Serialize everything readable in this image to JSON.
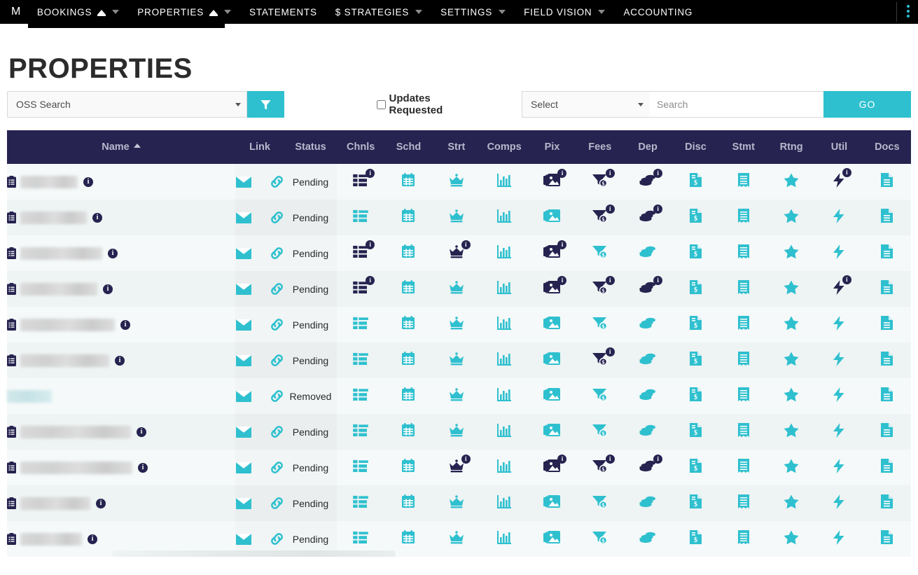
{
  "navbar": {
    "brand": "M",
    "items": [
      {
        "label": "BOOKINGS",
        "icon": "tab-badge-icon",
        "has_badge": true,
        "has_caret": true,
        "active": false
      },
      {
        "label": "PROPERTIES",
        "icon": "tab-badge-icon",
        "has_badge": true,
        "has_caret": true,
        "active": true
      },
      {
        "label": "STATEMENTS",
        "icon": "",
        "has_badge": false,
        "has_caret": false,
        "active": false
      },
      {
        "label": "$ STRATEGIES",
        "icon": "",
        "has_badge": false,
        "has_caret": true,
        "active": false
      },
      {
        "label": "SETTINGS",
        "icon": "",
        "has_badge": false,
        "has_caret": true,
        "active": false
      },
      {
        "label": "FIELD VISION",
        "icon": "",
        "has_badge": false,
        "has_caret": true,
        "active": false
      },
      {
        "label": "ACCOUNTING",
        "icon": "",
        "has_badge": false,
        "has_caret": false,
        "active": false
      }
    ],
    "kebab_icon": "vertical-dots-icon",
    "accent": "#2fc0cf"
  },
  "page": {
    "title": "PROPERTIES"
  },
  "filterbar": {
    "oss_select_value": "OSS Search",
    "filter_button_icon": "funnel-icon",
    "updates_requested_label": "Updates Requested",
    "updates_requested_checked": false,
    "type_select_value": "Select",
    "search_value": "",
    "search_placeholder": "Search",
    "go_label": "GO"
  },
  "table": {
    "columns": [
      {
        "key": "name",
        "label": "Name",
        "sorted": "asc"
      },
      {
        "key": "link",
        "label": "Link"
      },
      {
        "key": "status",
        "label": "Status"
      },
      {
        "key": "chnls",
        "label": "Chnls"
      },
      {
        "key": "schd",
        "label": "Schd"
      },
      {
        "key": "strt",
        "label": "Strt"
      },
      {
        "key": "comps",
        "label": "Comps"
      },
      {
        "key": "pix",
        "label": "Pix"
      },
      {
        "key": "fees",
        "label": "Fees"
      },
      {
        "key": "dep",
        "label": "Dep"
      },
      {
        "key": "disc",
        "label": "Disc"
      },
      {
        "key": "stmt",
        "label": "Stmt"
      },
      {
        "key": "rtng",
        "label": "Rtng"
      },
      {
        "key": "util",
        "label": "Util"
      },
      {
        "key": "docs",
        "label": "Docs"
      }
    ],
    "icon_names": {
      "name": "clipboard-icon",
      "info": "info-badge-icon",
      "mail": "envelope-icon",
      "link": "link-chain-icon",
      "chnls": "channels-list-icon",
      "schd": "calendar-icon",
      "strt": "crown-icon",
      "comps": "bar-chart-icon",
      "pix": "photos-icon",
      "fees": "funnel-dollar-icon",
      "dep": "coins-icon",
      "disc": "dollar-document-icon",
      "stmt": "receipt-icon",
      "rtng": "star-icon",
      "util": "lightning-bolt-icon",
      "docs": "document-icon"
    },
    "rows": [
      {
        "name_redacted": true,
        "name_width": 82,
        "has_clipboard": true,
        "has_info": true,
        "status": "Pending",
        "badges": {
          "chnls": true,
          "schd": false,
          "strt": false,
          "comps": false,
          "pix": true,
          "fees": true,
          "dep": true,
          "disc": false,
          "stmt": false,
          "rtng": false,
          "util": true,
          "docs": false
        }
      },
      {
        "name_redacted": true,
        "name_width": 95,
        "has_clipboard": true,
        "has_info": true,
        "status": "Pending",
        "badges": {
          "chnls": false,
          "schd": false,
          "strt": false,
          "comps": false,
          "pix": false,
          "fees": true,
          "dep": true,
          "disc": false,
          "stmt": false,
          "rtng": false,
          "util": false,
          "docs": false
        }
      },
      {
        "name_redacted": true,
        "name_width": 117,
        "has_clipboard": true,
        "has_info": true,
        "status": "Pending",
        "badges": {
          "chnls": true,
          "schd": false,
          "strt": true,
          "comps": false,
          "pix": true,
          "fees": false,
          "dep": false,
          "disc": false,
          "stmt": false,
          "rtng": false,
          "util": false,
          "docs": false
        }
      },
      {
        "name_redacted": true,
        "name_width": 110,
        "has_clipboard": true,
        "has_info": true,
        "status": "Pending",
        "badges": {
          "chnls": true,
          "schd": false,
          "strt": false,
          "comps": false,
          "pix": true,
          "fees": true,
          "dep": true,
          "disc": false,
          "stmt": false,
          "rtng": false,
          "util": true,
          "docs": false
        }
      },
      {
        "name_redacted": true,
        "name_width": 135,
        "has_clipboard": true,
        "has_info": true,
        "status": "Pending",
        "badges": {
          "chnls": false,
          "schd": false,
          "strt": false,
          "comps": false,
          "pix": false,
          "fees": false,
          "dep": false,
          "disc": false,
          "stmt": false,
          "rtng": false,
          "util": false,
          "docs": false
        }
      },
      {
        "name_redacted": true,
        "name_width": 127,
        "has_clipboard": true,
        "has_info": true,
        "status": "Pending",
        "badges": {
          "chnls": false,
          "schd": false,
          "strt": false,
          "comps": false,
          "pix": false,
          "fees": true,
          "dep": false,
          "disc": false,
          "stmt": false,
          "rtng": false,
          "util": false,
          "docs": false
        }
      },
      {
        "name_redacted": true,
        "name_width": 64,
        "name_tint": "teal",
        "has_clipboard": false,
        "has_info": false,
        "status": "Removed",
        "badges": {
          "chnls": false,
          "schd": false,
          "strt": false,
          "comps": false,
          "pix": false,
          "fees": false,
          "dep": false,
          "disc": false,
          "stmt": false,
          "rtng": false,
          "util": false,
          "docs": false
        }
      },
      {
        "name_redacted": true,
        "name_width": 158,
        "has_clipboard": true,
        "has_info": true,
        "status": "Pending",
        "badges": {
          "chnls": false,
          "schd": false,
          "strt": false,
          "comps": false,
          "pix": false,
          "fees": false,
          "dep": false,
          "disc": false,
          "stmt": false,
          "rtng": false,
          "util": false,
          "docs": false
        }
      },
      {
        "name_redacted": true,
        "name_width": 160,
        "has_clipboard": true,
        "has_info": true,
        "status": "Pending",
        "badges": {
          "chnls": false,
          "schd": false,
          "strt": true,
          "comps": false,
          "pix": true,
          "fees": true,
          "dep": true,
          "disc": false,
          "stmt": false,
          "rtng": false,
          "util": false,
          "docs": false
        }
      },
      {
        "name_redacted": true,
        "name_width": 100,
        "has_clipboard": true,
        "has_info": true,
        "status": "Pending",
        "badges": {
          "chnls": false,
          "schd": false,
          "strt": false,
          "comps": false,
          "pix": false,
          "fees": false,
          "dep": false,
          "disc": false,
          "stmt": false,
          "rtng": false,
          "util": false,
          "docs": false
        }
      },
      {
        "name_redacted": true,
        "name_width": 88,
        "has_clipboard": true,
        "has_info": true,
        "status": "Pending",
        "badges": {
          "chnls": false,
          "schd": false,
          "strt": false,
          "comps": false,
          "pix": false,
          "fees": false,
          "dep": false,
          "disc": false,
          "stmt": false,
          "rtng": false,
          "util": false,
          "docs": false
        }
      }
    ]
  },
  "colors": {
    "accent_teal": "#2fc0cf",
    "navy": "#262350",
    "header_navy": "#262350",
    "header_name_navy": "#3b3765",
    "row_odd": "#f5f9f9",
    "row_even": "#eef3f3"
  }
}
